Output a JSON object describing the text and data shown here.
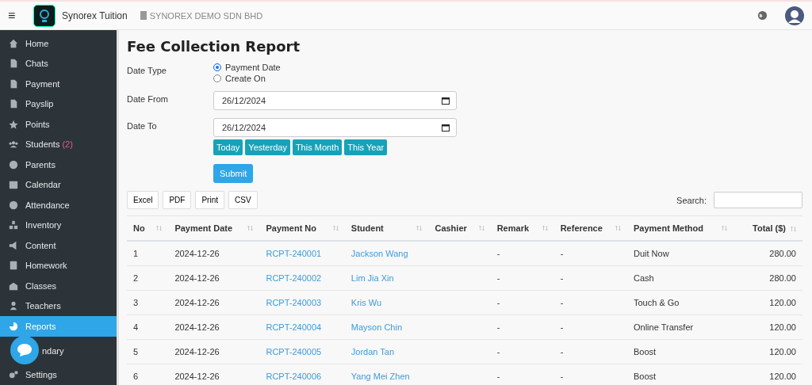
{
  "topbar": {
    "menu": "≡",
    "brand": "Synorex Tuition",
    "company": "SYNOREX DEMO SDN BHD"
  },
  "sidebar": {
    "items": [
      {
        "label": "Home",
        "selected": false
      },
      {
        "label": "Chats",
        "selected": false
      },
      {
        "label": "Payment",
        "selected": false
      },
      {
        "label": "Payslip",
        "selected": false
      },
      {
        "label": "Points",
        "selected": false
      },
      {
        "label": "Students",
        "count": "(2)",
        "selected": false
      },
      {
        "label": "Parents",
        "selected": false
      },
      {
        "label": "Calendar",
        "selected": false
      },
      {
        "label": "Attendance",
        "selected": false
      },
      {
        "label": "Inventory",
        "selected": false
      },
      {
        "label": "Content",
        "selected": false
      },
      {
        "label": "Homework",
        "selected": false
      },
      {
        "label": "Classes",
        "selected": false
      },
      {
        "label": "Teachers",
        "selected": false
      },
      {
        "label": "Reports",
        "selected": true
      },
      {
        "label": "ndary",
        "selected": false,
        "covered": true
      },
      {
        "label": "Settings",
        "selected": false
      }
    ]
  },
  "page": {
    "title": "Fee Collection Report",
    "date_type": {
      "label": "Date Type",
      "options": [
        {
          "label": "Payment Date",
          "selected": true
        },
        {
          "label": "Create On",
          "selected": false
        }
      ]
    },
    "date_from": {
      "label": "Date From",
      "value": "26/12/2024"
    },
    "date_to": {
      "label": "Date To",
      "value": "26/12/2024"
    },
    "quick_ranges": [
      "Today",
      "Yesterday",
      "This Month",
      "This Year"
    ],
    "submit": "Submit",
    "export_buttons": [
      "Excel",
      "PDF",
      "Print",
      "CSV"
    ],
    "search": {
      "label": "Search:"
    },
    "table": {
      "columns": [
        {
          "label": "No"
        },
        {
          "label": "Payment Date"
        },
        {
          "label": "Payment No"
        },
        {
          "label": "Student"
        },
        {
          "label": "Cashier"
        },
        {
          "label": "Remark"
        },
        {
          "label": "Reference"
        },
        {
          "label": "Payment Method"
        },
        {
          "label": "Total ($)"
        }
      ],
      "rows": [
        [
          "1",
          "2024-12-26",
          "RCPT-240001",
          "Jackson Wang",
          "",
          "-",
          "-",
          "Duit Now",
          "280.00"
        ],
        [
          "2",
          "2024-12-26",
          "RCPT-240002",
          "Lim Jia Xin",
          "",
          "-",
          "-",
          "Cash",
          "280.00"
        ],
        [
          "3",
          "2024-12-26",
          "RCPT-240003",
          "Kris Wu",
          "",
          "-",
          "-",
          "Touch & Go",
          "120.00"
        ],
        [
          "4",
          "2024-12-26",
          "RCPT-240004",
          "Mayson Chin",
          "",
          "-",
          "-",
          "Online Transfer",
          "120.00"
        ],
        [
          "5",
          "2024-12-26",
          "RCPT-240005",
          "Jordan Tan",
          "",
          "-",
          "-",
          "Boost",
          "120.00"
        ],
        [
          "6",
          "2024-12-26",
          "RCPT-240006",
          "Yang Mei Zhen",
          "",
          "-",
          "-",
          "Boost",
          "120.00"
        ]
      ]
    }
  }
}
